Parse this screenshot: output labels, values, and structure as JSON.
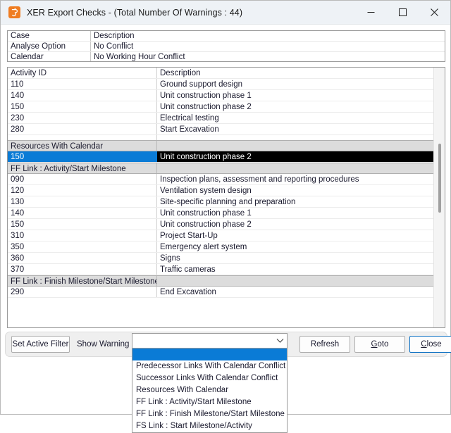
{
  "window": {
    "title": "XER Export Checks - (Total Number Of Warnings : 44)",
    "icon": "app-icon",
    "minimize_label": "Minimize",
    "maximize_label": "Maximize",
    "close_label": "Close"
  },
  "summary": {
    "header": {
      "case": "Case",
      "description": "Description"
    },
    "rows": [
      {
        "case": "Analyse Option",
        "description": "No Conflict"
      },
      {
        "case": "Calendar",
        "description": "No Working Hour Conflict"
      }
    ]
  },
  "list": {
    "header": {
      "id": "Activity ID",
      "description": "Description"
    },
    "rows": [
      {
        "type": "header",
        "id": "Activity ID",
        "description": "Description"
      },
      {
        "type": "data",
        "id": "110",
        "description": "Ground support design"
      },
      {
        "type": "data",
        "id": "140",
        "description": "Unit construction phase 1"
      },
      {
        "type": "data",
        "id": "150",
        "description": "Unit construction phase 2"
      },
      {
        "type": "data",
        "id": "230",
        "description": "Electrical testing"
      },
      {
        "type": "data",
        "id": "280",
        "description": "Start Excavation"
      },
      {
        "type": "spacer",
        "id": "",
        "description": ""
      },
      {
        "type": "group",
        "id": "Resources With Calendar",
        "description": ""
      },
      {
        "type": "selected",
        "id": "150",
        "description": "Unit construction phase 2"
      },
      {
        "type": "group",
        "id": "FF Link : Activity/Start Milestone",
        "description": ""
      },
      {
        "type": "data",
        "id": "090",
        "description": "Inspection plans, assessment and reporting procedures"
      },
      {
        "type": "data",
        "id": "120",
        "description": "Ventilation system design"
      },
      {
        "type": "data",
        "id": "130",
        "description": "Site-specific planning and preparation"
      },
      {
        "type": "data",
        "id": "140",
        "description": "Unit construction phase 1"
      },
      {
        "type": "data",
        "id": "150",
        "description": "Unit construction phase 2"
      },
      {
        "type": "data",
        "id": "310",
        "description": "Project Start-Up"
      },
      {
        "type": "data",
        "id": "350",
        "description": "Emergency alert system"
      },
      {
        "type": "data",
        "id": "360",
        "description": "Signs"
      },
      {
        "type": "data",
        "id": "370",
        "description": "Traffic cameras"
      },
      {
        "type": "group",
        "id": "FF Link : Finish Milestone/Start  Milestone",
        "description": ""
      },
      {
        "type": "data",
        "id": "290",
        "description": "End Excavation"
      }
    ]
  },
  "toolbar": {
    "set_active_filter_label": "Set Active Filter",
    "show_warning_label": "Show Warning :",
    "refresh_label": "Refresh",
    "goto_label": "Goto",
    "goto_accel": "G",
    "close_label": "Close",
    "close_accel": "C"
  },
  "combo": {
    "value": "",
    "placeholder": "",
    "arrow_icon": "chevron-down-icon",
    "expanded": true,
    "options": [
      {
        "label": "",
        "selected": true
      },
      {
        "label": "Predecessor Links With Calendar Conflict",
        "selected": false
      },
      {
        "label": "Successor Links With Calendar Conflict",
        "selected": false
      },
      {
        "label": "Resources With Calendar",
        "selected": false
      },
      {
        "label": "FF Link : Activity/Start Milestone",
        "selected": false
      },
      {
        "label": "FF Link : Finish Milestone/Start  Milestone",
        "selected": false
      },
      {
        "label": "FS Link : Start Milestone/Activity",
        "selected": false
      }
    ]
  },
  "colors": {
    "accent_blue": "#0a7bd6",
    "icon_orange": "#ef7d22",
    "selected_row_bg": "#000000",
    "group_row_bg": "#dcdcdc"
  }
}
